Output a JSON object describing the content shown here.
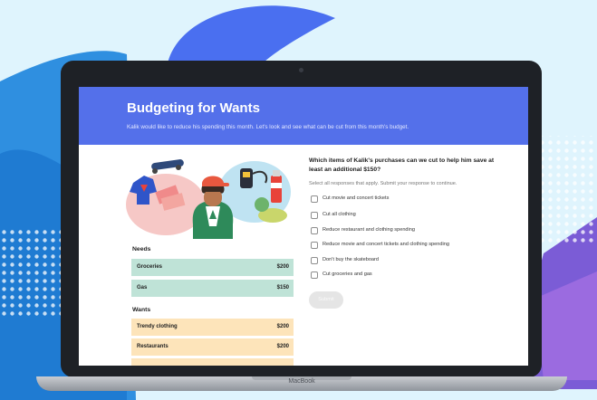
{
  "page": {
    "title": "Budgeting for Wants",
    "subtitle": "Kalik would like to reduce his spending this month. Let's look and see what can be cut from this month's budget."
  },
  "colors": {
    "header": "#5470ea",
    "needs_row": "#bfe3d7",
    "wants_row": "#fde4ba",
    "background": "#dff4fd"
  },
  "illustration": {
    "icon": "teen-with-purchases-illustration"
  },
  "budget": {
    "needs_label": "Needs",
    "needs": [
      {
        "label": "Groceries",
        "amount": "$200"
      },
      {
        "label": "Gas",
        "amount": "$150"
      }
    ],
    "wants_label": "Wants",
    "wants": [
      {
        "label": "Trendy clothing",
        "amount": "$200"
      },
      {
        "label": "Restaurants",
        "amount": "$200"
      }
    ]
  },
  "question": {
    "text": "Which items of Kalik's purchases can we cut to help him save at least an additional $150?",
    "instruction": "Select all responses that apply. Submit your response to continue.",
    "options": [
      {
        "label": "Cut movie and concert tickets",
        "checked": false
      },
      {
        "label": "Cut all clothing",
        "checked": false
      },
      {
        "label": "Reduce restaurant and clothing spending",
        "checked": false
      },
      {
        "label": "Reduce movie and concert tickets and clothing spending",
        "checked": false
      },
      {
        "label": "Don't buy the skateboard",
        "checked": false
      },
      {
        "label": "Cut groceries and gas",
        "checked": false
      }
    ],
    "submit_label": "Submit"
  },
  "device": {
    "brand": "MacBook"
  }
}
